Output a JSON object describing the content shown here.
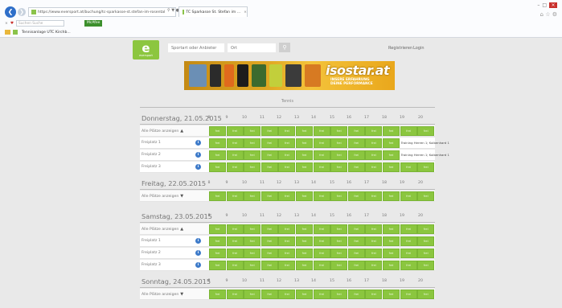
{
  "browser": {
    "url": "https://www.eversport.at/buchung/tc-sparkasse-st.stefan-im-rosental",
    "tab_title": "TC Sparkasse St. Stefan im ...",
    "search_placeholder": "Suchen Suche",
    "mcafee_label": "McAfee",
    "favorite": "Tennisanlage UTC Kirchb..."
  },
  "header": {
    "logo_text": "eversport",
    "sport_placeholder": "Sportart oder Anbieter",
    "place_placeholder": "Ort",
    "register": "Registrieren",
    "login": "Login"
  },
  "banner": {
    "brand": "isostar.at",
    "tagline_1": "INSERE ERFAHRUNG",
    "tagline_2": "DEINE PERFORMANCE"
  },
  "section_title": "Tennis",
  "hours": [
    "8",
    "9",
    "10",
    "11",
    "12",
    "13",
    "14",
    "15",
    "16",
    "17",
    "18",
    "19",
    "20"
  ],
  "slot_label": "frei",
  "booked_label": "Training Herren 1; Kolbenhard 1",
  "days": [
    {
      "title": "Donnerstag, 21.05.2015",
      "toggle": "Alle Plätze anzeigen",
      "expanded": true,
      "courts": [
        {
          "name": "Freiplatz 1",
          "booked_from": 11
        },
        {
          "name": "Freiplatz 2",
          "booked_from": 11
        },
        {
          "name": "Freiplatz 3",
          "booked_from": null
        }
      ]
    },
    {
      "title": "Freitag, 22.05.2015",
      "toggle": "Alle Plätze anzeigen",
      "expanded": false,
      "courts": []
    },
    {
      "title": "Samstag, 23.05.2015",
      "toggle": "Alle Plätze anzeigen",
      "expanded": true,
      "courts": [
        {
          "name": "Freiplatz 1",
          "booked_from": null
        },
        {
          "name": "Freiplatz 2",
          "booked_from": null
        },
        {
          "name": "Freiplatz 3",
          "booked_from": null
        }
      ]
    },
    {
      "title": "Sonntag, 24.05.2015",
      "toggle": "Alle Plätze anzeigen",
      "expanded": false,
      "courts": []
    }
  ]
}
